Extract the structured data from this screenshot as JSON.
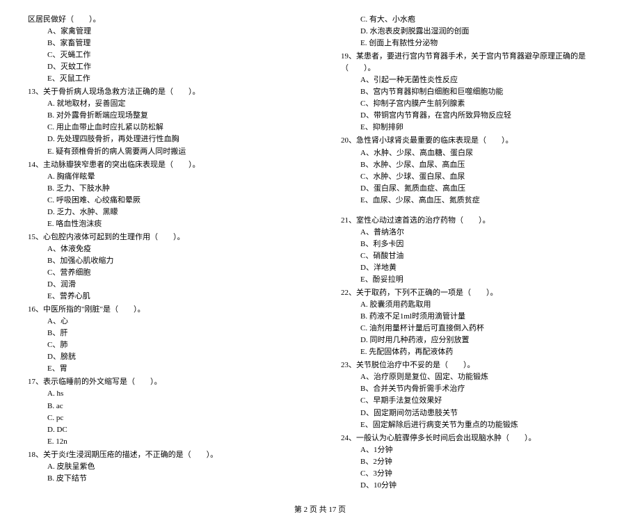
{
  "left": {
    "stem12cont": "区居民做好（　　）。",
    "q12": {
      "A": "A、家禽管理",
      "B": "B、家畜管理",
      "C": "C、灭蝇工作",
      "D": "D、灭蚊工作",
      "E": "E、灭鼠工作"
    },
    "q13": {
      "stem": "13、关于骨折病人现场急救方法正确的是（　　）。",
      "A": "A. 就地取材，妥善固定",
      "B": "B. 对外露骨折断端应现场整复",
      "C": "C. 用止血带止血时应扎紧以防松解",
      "D": "D. 先处理四肢骨折，再处理进行性血胸",
      "E": "E. 疑有颈椎骨折的病人需要两人同时搬运"
    },
    "q14": {
      "stem": "14、主动脉瓣狭窄患者的突出临床表现是（　　）。",
      "A": "A. 胸痛伴眩晕",
      "B": "B. 乏力、下肢水肿",
      "C": "C. 呼吸困难、心绞痛和晕厥",
      "D": "D. 乏力、水肿、黑矇",
      "E": "E. 咯血性泡沫痰"
    },
    "q15": {
      "stem": "15、心包腔内液体可起到的生理作用（　　）。",
      "A": "A、体液免疫",
      "B": "B、加强心肌收缩力",
      "C": "C、营养细胞",
      "D": "D、润滑",
      "E": "E、营养心肌"
    },
    "q16": {
      "stem": "16、中医所指的\"刚脏\"是（　　）。",
      "A": "A、心",
      "B": "B、肝",
      "C": "C、肺",
      "D": "D、膀胱",
      "E": "E、胃"
    },
    "q17": {
      "stem": "17、表示临睡前的外文缩写是（　　）。",
      "A": "A. hs",
      "B": "B. ac",
      "C": "C. pc",
      "D": "D. DC",
      "E": "E. 12n"
    },
    "q18": {
      "stem": "18、关于炎f生浸润期压疮的描述，不正确的是（　　）。",
      "A": "A. 皮肤呈紫色",
      "B": "B. 皮下结节"
    }
  },
  "right": {
    "q18c": {
      "C": "C. 有大、小水疱",
      "D": "D. 水泡表皮剥脱露出湿润的创面",
      "E": "E. 创面上有脓性分泌物"
    },
    "q19": {
      "stem": "19、某患者，要进行宫内节育器手术，关于宫内节育器避孕原理正确的是（　　）。",
      "A": "A、引起一种无菌性炎性反应",
      "B": "B、宫内节育器抑制白细胞和巨噬细胞功能",
      "C": "C、抑制子宫内膜产生前列腺素",
      "D": "D、带铜宫内节育器，在宫内所致异物反应轻",
      "E": "E、抑制排卵"
    },
    "q20": {
      "stem": "20、急性肾小球肾炎最重要的临床表现是（　　）。",
      "A": "A、水肿、少尿、高血糖、蛋白尿",
      "B": "B、水肿、少尿、血尿、高血压",
      "C": "C、水肿、少球、蛋白尿、血尿",
      "D": "D、蛋白尿、氮质血症、高血压",
      "E": "E、血尿、少尿、高血压、氮质贫症"
    },
    "q21": {
      "stem": "21、室性心动过速首选的治疗药物（　　）。",
      "A": "A、普纳洛尔",
      "B": "B、利多卡因",
      "C": "C、硝酸甘油",
      "D": "D、洋地黄",
      "E": "E、酚妥拉明"
    },
    "q22": {
      "stem": "22、关于取药，下列不正确的一项是（　　）。",
      "A": "A. 胶囊须用药匙取用",
      "B": "B. 药液不足1ml时须用滴管计量",
      "C": "C. 油剂用量杯计量后可直接倒入药杯",
      "D": "D. 同时用几种药液，应分别放置",
      "E": "E. 先配固体药，再配液体药"
    },
    "q23": {
      "stem": "23、关节脱位治疗中不妥的是（　　）。",
      "A": "A、治疗原则是复位、固定、功能锻炼",
      "B": "B、合并关节内骨折需手术治疗",
      "C": "C、早期手法复位效果好",
      "D": "D、固定期间勿活动患肢关节",
      "E": "E、固定解除后进行病变关节为重点的功能锻炼"
    },
    "q24": {
      "stem": "24、一般认为心脏骤停多长时间后会出现脑水肿（　　）。",
      "A": "A、1分钟",
      "B": "B、2分钟",
      "C": "C、3分钟",
      "D": "D、10分钟"
    }
  },
  "footer": "第 2 页 共 17 页"
}
